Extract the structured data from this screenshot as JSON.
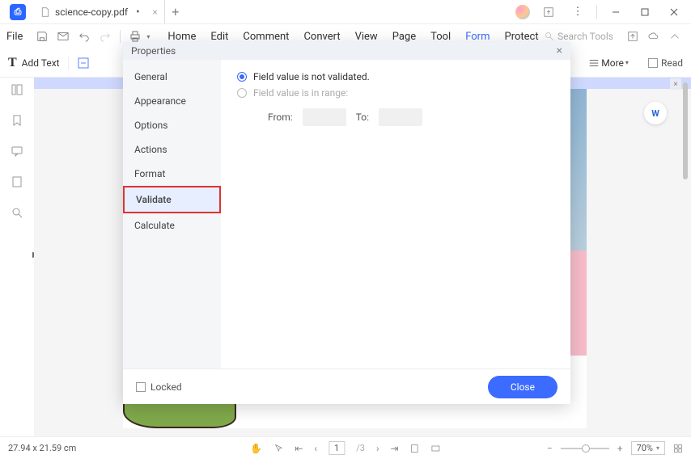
{
  "tab": {
    "name": "science-copy.pdf",
    "unsaved_marker": "•"
  },
  "file_label": "File",
  "menu": [
    "Home",
    "Edit",
    "Comment",
    "Convert",
    "View",
    "Page",
    "Tool",
    "Form",
    "Protect"
  ],
  "menu_active_index": 7,
  "search_placeholder": "Search Tools",
  "toolrow": {
    "add_text": "Add Text",
    "more": "More",
    "read": "Read"
  },
  "dialog": {
    "title": "Properties",
    "tabs": [
      "General",
      "Appearance",
      "Options",
      "Actions",
      "Format",
      "Validate",
      "Calculate"
    ],
    "selected_tab_index": 5,
    "opt1": "Field value is not validated.",
    "opt2": "Field value is in range:",
    "from_label": "From:",
    "to_label": "To:",
    "from_value": "",
    "to_value": "",
    "locked": "Locked",
    "close": "Close"
  },
  "status": {
    "dimensions": "27.94 x 21.59 cm",
    "page_current": "1",
    "page_total": "/3",
    "zoom": "70%"
  }
}
